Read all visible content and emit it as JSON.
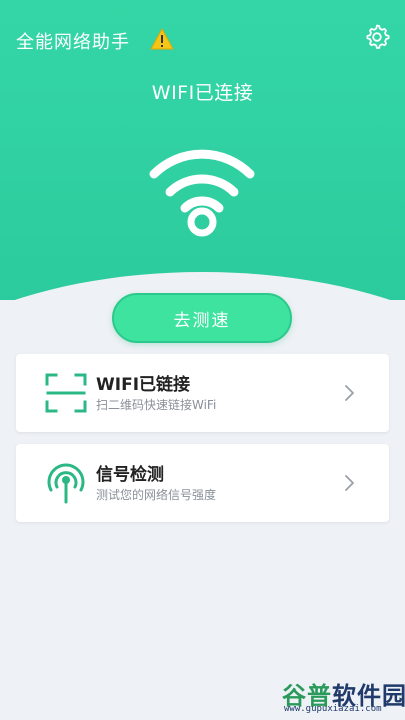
{
  "header": {
    "app_title": "全能网络助手",
    "icons": {
      "warning": "warning-icon",
      "settings": "gear-icon"
    }
  },
  "status": {
    "text": "WIFI已连接"
  },
  "actions": {
    "speed_test_label": "去测速"
  },
  "cards": [
    {
      "title": "WIFI已链接",
      "subtitle": "扫二维码快速链接WiFi",
      "icon": "scan-icon"
    },
    {
      "title": "信号检测",
      "subtitle": "测试您的网络信号强度",
      "icon": "signal-tower-icon"
    }
  ],
  "watermark": {
    "brand_a": "谷普",
    "brand_b": "软件园",
    "url": "www.gupuxiazai.com"
  },
  "colors": {
    "hero": "#2ccb9d",
    "accent": "#3ee39f",
    "icon_green": "#2bb884",
    "background": "#eef1f5",
    "card": "#ffffff"
  }
}
